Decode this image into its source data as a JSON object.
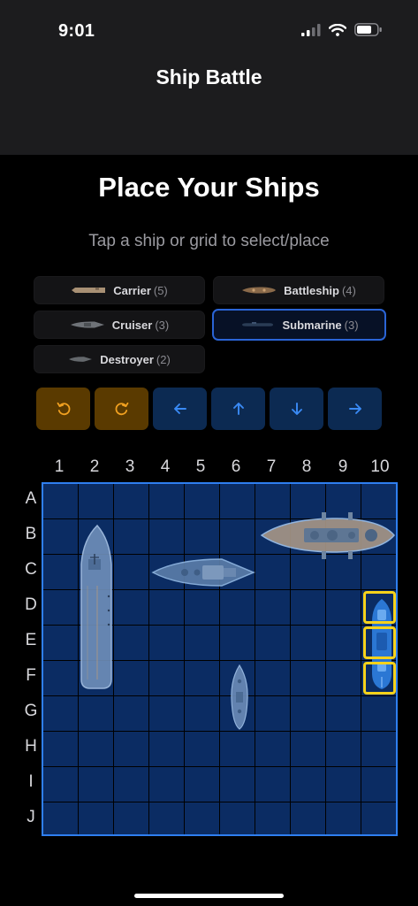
{
  "status_bar": {
    "time": "9:01"
  },
  "nav": {
    "title": "Ship Battle"
  },
  "page": {
    "title": "Place Your Ships",
    "subtitle": "Tap a ship or grid to select/place"
  },
  "ships": [
    {
      "name": "Carrier",
      "size": "(5)",
      "selected": false
    },
    {
      "name": "Battleship",
      "size": "(4)",
      "selected": false
    },
    {
      "name": "Cruiser",
      "size": "(3)",
      "selected": false
    },
    {
      "name": "Submarine",
      "size": "(3)",
      "selected": true
    },
    {
      "name": "Destroyer",
      "size": "(2)",
      "selected": false
    }
  ],
  "controls": [
    {
      "icon": "rotate-left-icon",
      "color": "#f0a020"
    },
    {
      "icon": "rotate-right-icon",
      "color": "#f0a020"
    },
    {
      "icon": "arrow-left-icon",
      "color": "#3a8af5"
    },
    {
      "icon": "arrow-up-icon",
      "color": "#3a8af5"
    },
    {
      "icon": "arrow-down-icon",
      "color": "#3a8af5"
    },
    {
      "icon": "arrow-right-icon",
      "color": "#3a8af5"
    }
  ],
  "grid": {
    "columns": [
      "1",
      "2",
      "3",
      "4",
      "5",
      "6",
      "7",
      "8",
      "9",
      "10"
    ],
    "rows": [
      "A",
      "B",
      "C",
      "D",
      "E",
      "F",
      "G",
      "H",
      "I",
      "J"
    ],
    "placed": [
      {
        "ship": "Carrier",
        "cells": [
          "B2",
          "C2",
          "D2",
          "E2",
          "F2"
        ]
      },
      {
        "ship": "Battleship",
        "cells": [
          "B7",
          "B8",
          "B9",
          "B10"
        ]
      },
      {
        "ship": "Cruiser",
        "cells": [
          "C4",
          "C5",
          "C6"
        ]
      },
      {
        "ship": "Destroyer",
        "cells": [
          "F6",
          "G6"
        ]
      },
      {
        "ship": "Submarine",
        "cells": [
          "D10",
          "E10",
          "F10"
        ],
        "highlighted": true
      }
    ]
  },
  "colors": {
    "grid_fill": "#0b2c63",
    "grid_border": "#2f7ff0",
    "highlight": "#f6d21a",
    "selected_border": "#2a64d6"
  }
}
